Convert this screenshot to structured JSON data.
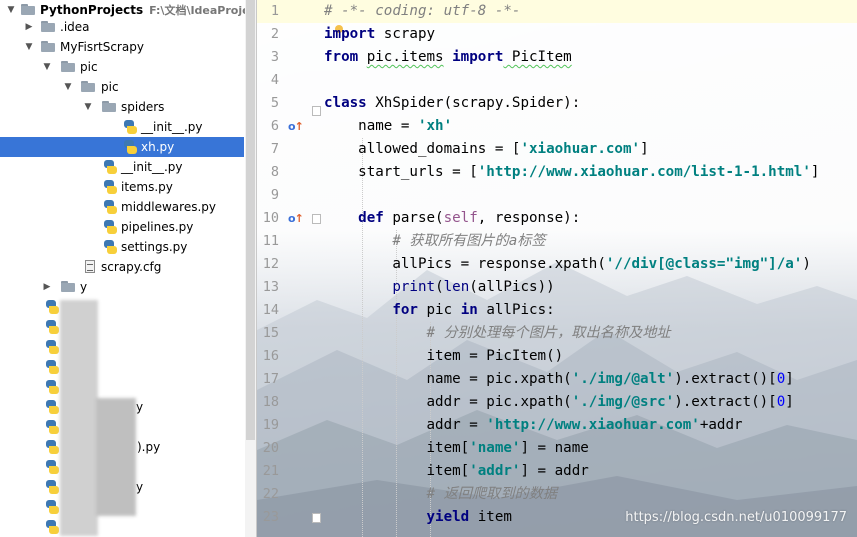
{
  "project_tree": {
    "root": {
      "label": "PythonProjects",
      "path": "F:\\文档\\IdeaProjects\\Py"
    },
    "items": [
      {
        "label": ".idea"
      },
      {
        "label": "MyFisrtScrapy"
      },
      {
        "label": "pic"
      },
      {
        "label": "pic"
      },
      {
        "label": "spiders"
      },
      {
        "label": "__init__.py"
      },
      {
        "label": "xh.py"
      },
      {
        "label": "__init__.py"
      },
      {
        "label": "items.py"
      },
      {
        "label": "middlewares.py"
      },
      {
        "label": "pipelines.py"
      },
      {
        "label": "settings.py"
      },
      {
        "label": "scrapy.cfg"
      },
      {
        "label": "y"
      }
    ],
    "obscured_fragments": [
      "y",
      ").py",
      "y"
    ],
    "selected": "xh.py"
  },
  "editor": {
    "line_numbers": [
      "1",
      "2",
      "3",
      "4",
      "5",
      "6",
      "7",
      "8",
      "9",
      "10",
      "11",
      "12",
      "13",
      "14",
      "15",
      "16",
      "17",
      "18",
      "19",
      "20",
      "21",
      "22",
      "23"
    ],
    "code": {
      "l1": "# -*- coding: utf-8 -*-",
      "l2_kw": "import",
      "l2_rest": " scrapy",
      "l3_kw1": "from",
      "l3_mod": "pic.items",
      "l3_kw2": "import",
      "l3_rest": " PicItem",
      "l5_kw": "class",
      "l5_rest": " XhSpider(scrapy.Spider):",
      "l6_a": "    name = ",
      "l6_s": "'xh'",
      "l7_a": "    allowed_domains = [",
      "l7_s": "'xiaohuar.com'",
      "l7_b": "]",
      "l8_a": "    start_urls = [",
      "l8_s": "'http://www.xiaohuar.com/list-1-1.html'",
      "l8_b": "]",
      "l10_kw": "def",
      "l10_a": " parse(",
      "l10_self": "self",
      "l10_b": ", response):",
      "l11": "        # 获取所有图片的a标签",
      "l12_a": "        allPics = response.xpath(",
      "l12_s": "'//div[@class=\"img\"]/a'",
      "l12_b": ")",
      "l13_bi": "print",
      "l13_a": "(",
      "l13_bi2": "len",
      "l13_b": "(allPics))",
      "l14_kw1": "for",
      "l14_a": " pic ",
      "l14_kw2": "in",
      "l14_b": " allPics:",
      "l15": "            # 分别处理每个图片，取出名称及地址",
      "l16": "            item = PicItem()",
      "l17_a": "            name = pic.xpath(",
      "l17_s": "'./img/@alt'",
      "l17_b": ").extract()[",
      "l17_n": "0",
      "l17_c": "]",
      "l18_a": "            addr = pic.xpath(",
      "l18_s": "'./img/@src'",
      "l18_b": ").extract()[",
      "l18_n": "0",
      "l18_c": "]",
      "l19_a": "            addr = ",
      "l19_s": "'http://www.xiaohuar.com'",
      "l19_b": "+addr",
      "l20_a": "            item[",
      "l20_s": "'name'",
      "l20_b": "] = name",
      "l21_a": "            item[",
      "l21_s": "'addr'",
      "l21_b": "] = addr",
      "l22": "            # 返回爬取到的数据",
      "l23_kw": "yield",
      "l23_rest": " item"
    },
    "gutter_markers": {
      "override": "o",
      "arrow": "↑"
    },
    "watermark": "https://blog.csdn.net/u010099177"
  },
  "colors": {
    "selection": "#3875d7",
    "keyword": "#000080",
    "string": "#008080",
    "comment": "#808080",
    "number": "#0000ff"
  }
}
